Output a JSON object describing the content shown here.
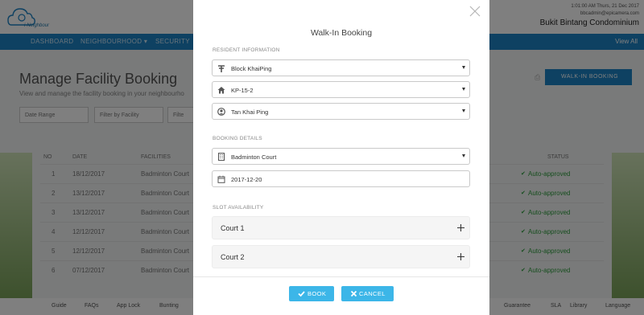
{
  "app": {
    "logo_text": "i-Neighbour",
    "user_time": "1:01:00 AM Thurs, 21 Dec 2017",
    "user_email": "bbcadmin@epicamera.com",
    "user_condo": "Bukit Bintang Condominium",
    "nav": [
      "DASHBOARD",
      "NEIGHBOURHOOD ▾",
      "SECURITY"
    ],
    "nav_right": "View All",
    "page_title": "Manage Facility Booking",
    "page_sub": "View and manage the facility booking in your neighbourho",
    "walkin_label": "WALK-IN BOOKING",
    "filters": [
      "Date Range",
      "Filter by Facility",
      "Filte"
    ],
    "table_headers": [
      "NO",
      "DATE",
      "FACILITIES",
      "STATUS"
    ],
    "rows": [
      {
        "no": "1",
        "date": "18/12/2017",
        "facility": "Badminton Court",
        "status": "Auto-approved"
      },
      {
        "no": "2",
        "date": "13/12/2017",
        "facility": "Badminton Court",
        "status": "Auto-approved"
      },
      {
        "no": "3",
        "date": "13/12/2017",
        "facility": "Badminton Court",
        "status": "Auto-approved"
      },
      {
        "no": "4",
        "date": "12/12/2017",
        "facility": "Badminton Court",
        "status": "Auto-approved"
      },
      {
        "no": "5",
        "date": "12/12/2017",
        "facility": "Badminton Court",
        "status": "Auto-approved"
      },
      {
        "no": "6",
        "date": "07/12/2017",
        "facility": "Badminton Court",
        "status": "Auto-approved"
      }
    ],
    "footer_left": [
      "Guide",
      "FAQs",
      "App Lock",
      "Bunting"
    ],
    "footer_right": [
      "Guarantee",
      "SLA",
      "Library",
      "Language"
    ]
  },
  "modal": {
    "title": "Walk-In Booking",
    "resident_section": "RESIDENT INFORMATION",
    "block": "Block KhaiPing",
    "unit": "KP-15-2",
    "resident": "Tan Khai Ping",
    "booking_section": "BOOKING DETAILS",
    "facility": "Badminton Court",
    "date": "2017-12-20",
    "slot_section": "SLOT AVAILABILITY",
    "courts": [
      "Court 1",
      "Court 2"
    ],
    "book_label": "BOOK",
    "cancel_label": "CANCEL"
  },
  "colors": {
    "primary_blue": "#1d82c4",
    "button_blue": "#3cb6e8",
    "approved_green": "#2e9d3d"
  },
  "icons": [
    "block-icon",
    "home-icon",
    "user-icon",
    "building-icon",
    "calendar-icon",
    "plus-icon",
    "check-icon",
    "times-icon",
    "close-icon"
  ]
}
